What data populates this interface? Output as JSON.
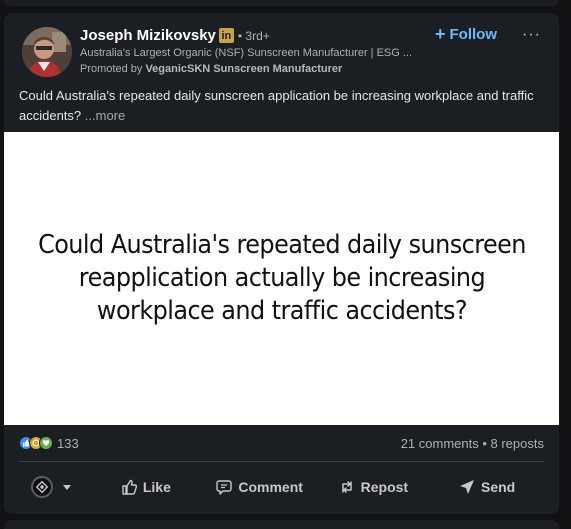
{
  "post": {
    "author_name": "Joseph Mizikovsky",
    "author_badge": "in",
    "degree": "• 3rd+",
    "headline": "Australia's Largest Organic (NSF) Sunscreen Manufacturer | ESG ...",
    "promoted_prefix": "Promoted by",
    "promoted_by": "VeganicSKN Sunscreen Manufacturer",
    "follow_label": "Follow",
    "follow_plus": "+",
    "more_menu": "···",
    "text": "Could Australia's repeated daily sunscreen application be increasing workplace and traffic accidents?",
    "see_more": "...more",
    "image_text": "Could Australia's repeated daily sunscreen reapplication actually be increasing workplace and traffic accidents?"
  },
  "social": {
    "reaction_count": "133",
    "comments": "21 comments",
    "separator": " • ",
    "reposts": "8 reposts"
  },
  "actions": {
    "like": "Like",
    "comment": "Comment",
    "repost": "Repost",
    "send": "Send"
  },
  "colors": {
    "background": "#101214",
    "card": "#1b1f23",
    "accent": "#71b7fb",
    "like_reaction": "#378fe9",
    "celebrate_reaction": "#d8a13a",
    "support_reaction": "#6dae4f"
  },
  "icons": [
    "profile-photo",
    "linkedin-icon",
    "plus-icon",
    "ellipsis-icon",
    "like-reaction-icon",
    "celebrate-reaction-icon",
    "support-reaction-icon",
    "actor-avatar",
    "chevron-down-icon",
    "thumbs-up-icon",
    "comment-icon",
    "repost-icon",
    "send-icon"
  ]
}
